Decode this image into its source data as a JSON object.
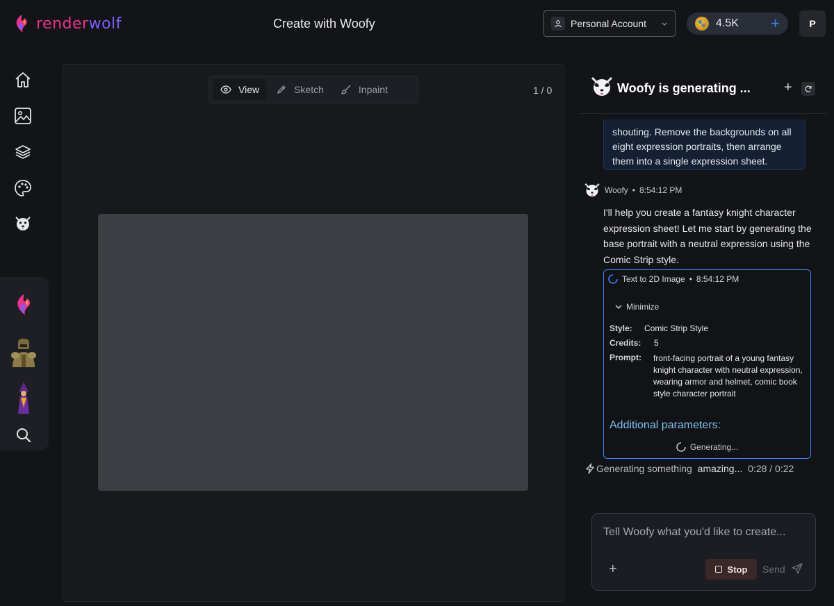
{
  "header": {
    "logo_part1": "render",
    "logo_part2": "wolf",
    "title": "Create with Woofy",
    "account_label": "Personal Account",
    "credits": "4.5K",
    "user_initial": "P"
  },
  "sidebar": {
    "nav": [
      {
        "name": "home-icon"
      },
      {
        "name": "image-icon"
      },
      {
        "name": "layers-icon"
      },
      {
        "name": "palette-icon"
      },
      {
        "name": "woofy-icon"
      }
    ],
    "recent": [
      {
        "name": "renderwolf-logo-thumb"
      },
      {
        "name": "knight-thumb"
      },
      {
        "name": "wizard-thumb"
      },
      {
        "name": "search-icon"
      }
    ]
  },
  "canvas": {
    "tools": [
      {
        "label": "View",
        "icon": "eye-icon",
        "active": true
      },
      {
        "label": "Sketch",
        "icon": "pencil-icon",
        "active": false
      },
      {
        "label": "Inpaint",
        "icon": "brush-icon",
        "active": false
      }
    ],
    "page_count": "1 / 0"
  },
  "chat": {
    "title": "Woofy is generating ...",
    "user_message": "shouting. Remove the backgrounds on all eight expression portraits, then arrange them into a single expression sheet.",
    "woofy_name": "Woofy",
    "woofy_time": "8:54:12 PM",
    "woofy_text": "I'll help you create a fantasy knight character expression sheet! Let me start by generating the base portrait with a neutral expression using the Comic Strip style.",
    "tool_card": {
      "tool_name": "Text to 2D Image",
      "time": "8:54:12 PM",
      "minimize_label": "Minimize",
      "style_label": "Style:",
      "style_value": "Comic Strip Style",
      "credits_label": "Credits:",
      "credits_value": "5",
      "prompt_label": "Prompt:",
      "prompt_value": "front-facing portrait of a young fantasy knight character with neutral expression, wearing armor and helmet, comic book style character portrait",
      "additional_label": "Additional parameters:",
      "generating_label": "Generating..."
    },
    "status": {
      "prefix": "Generating something",
      "emphasis": "amazing...",
      "timer": "0:28 / 0:22"
    },
    "composer": {
      "placeholder": "Tell Woofy what you'd like to create...",
      "stop_label": "Stop",
      "send_label": "Send"
    }
  },
  "colors": {
    "accent_blue": "#3b82f6",
    "logo_pink": "#e8338e",
    "logo_purple": "#7c5cff",
    "link_cyan": "#7dc3f0"
  }
}
